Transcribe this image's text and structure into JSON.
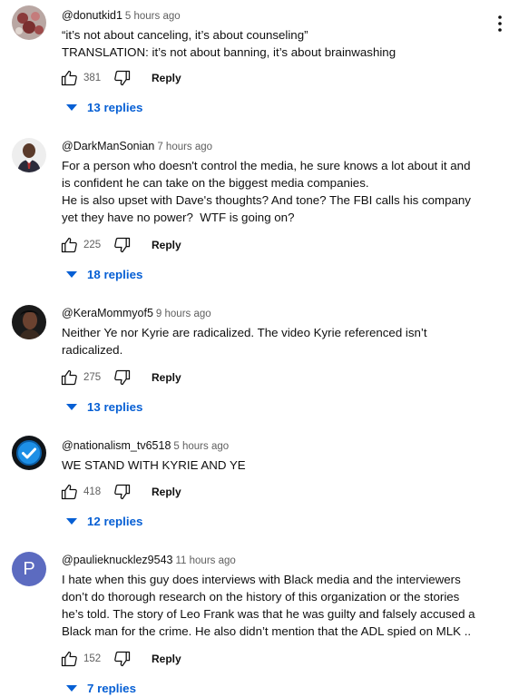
{
  "comments": [
    {
      "author": "@donutkid1",
      "time": "5 hours ago",
      "text": "“it’s not about canceling, it’s about counseling”\nTRANSLATION: it’s not about banning, it’s about brainwashing",
      "likes": "381",
      "reply_label": "Reply",
      "replies_label": "13 replies"
    },
    {
      "author": "@DarkManSonian",
      "time": "7 hours ago",
      "text": "For a person who doesn't control the media, he sure knows a lot about it and\nis confident he can take on the biggest media companies.\nHe is also upset with Dave's thoughts? And tone? The FBI calls his company\nyet they have no power?  WTF is going on?",
      "likes": "225",
      "reply_label": "Reply",
      "replies_label": "18 replies"
    },
    {
      "author": "@KeraMommyof5",
      "time": "9 hours ago",
      "text": "Neither Ye nor Kyrie are radicalized. The video Kyrie referenced isn’t\nradicalized.",
      "likes": "275",
      "reply_label": "Reply",
      "replies_label": "13 replies"
    },
    {
      "author": "@nationalism_tv6518",
      "time": "5 hours ago",
      "text": "WE STAND WITH KYRIE AND YE",
      "likes": "418",
      "reply_label": "Reply",
      "replies_label": "12 replies"
    },
    {
      "author": "@paulieknucklez9543",
      "time": "11 hours ago",
      "text": "I hate when this guy does interviews with Black media and the interviewers\ndon’t do thorough research on the history of this organization or the stories\nhe’s told. The story of Leo Frank was that he was guilty and falsely accused a\nBlack man for the crime. He also didn’t mention that the ADL spied on MLK ..",
      "likes": "152",
      "reply_label": "Reply",
      "replies_label": "7 replies",
      "avatar_letter": "P"
    }
  ],
  "colors": {
    "link_blue": "#065fd4",
    "secondary_text": "#606060",
    "avatar_p_bg": "#5c6bc0"
  }
}
